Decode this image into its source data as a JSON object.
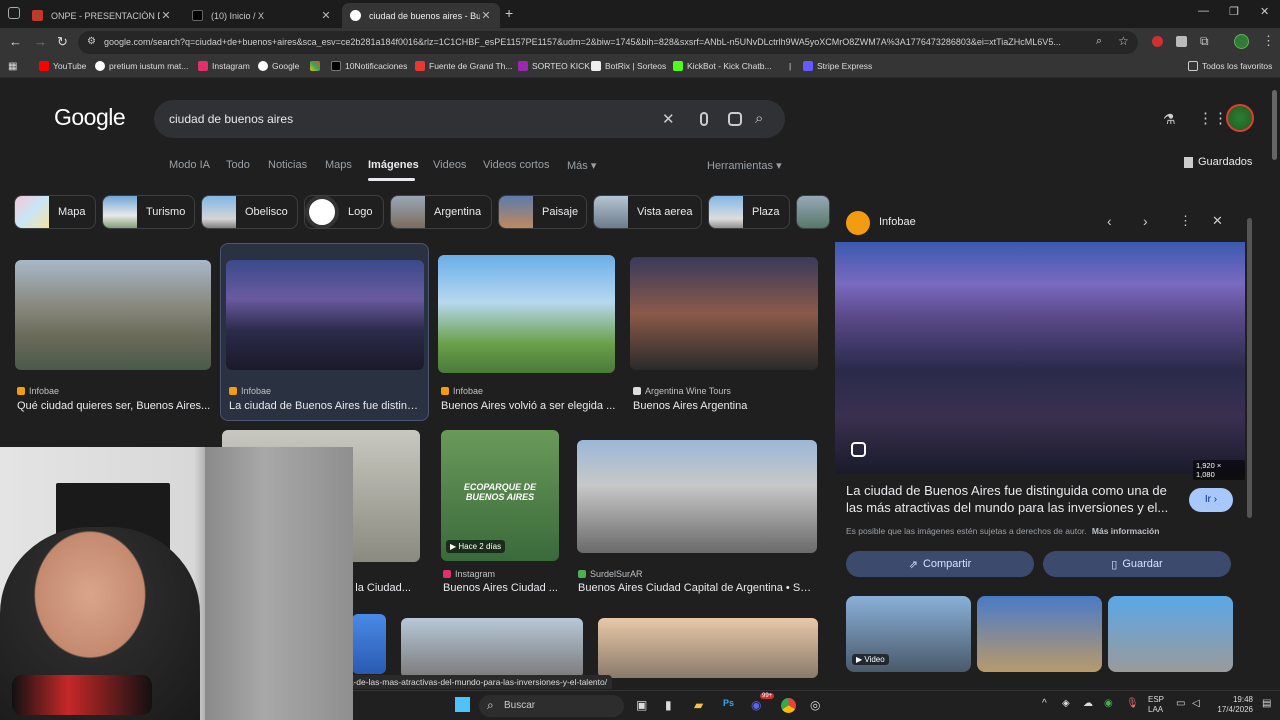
{
  "browser": {
    "tabs": [
      {
        "title": "ONPE - PRESENTACIÓN DE RES",
        "active": false
      },
      {
        "title": "(10) Inicio / X",
        "active": false
      },
      {
        "title": "ciudad de buenos aires - Busca",
        "active": true
      }
    ],
    "url": "google.com/search?q=ciudad+de+buenos+aires&sca_esv=ce2b281a184f0016&rlz=1C1CHBF_esPE1157PE1157&udm=2&biw=1745&bih=828&sxsrf=ANbL-n5UNvDLctrlh9WA5yoXCMrO8ZWM7A%3A1776473286803&ei=xtTiaZHcML6V5...",
    "bookmarks": [
      "YouTube",
      "pretium iustum mat...",
      "Instagram",
      "Google",
      "",
      "10Notificaciones",
      "Fuente de Grand Th...",
      "SORTEO KICK",
      "BotRix | Sorteos",
      "KickBot - Kick Chatb...",
      "|",
      "Stripe Express"
    ],
    "bookmarks_all": "Todos los favoritos"
  },
  "google": {
    "logo": "Google",
    "query": "ciudad de buenos aires",
    "nav": [
      "Modo IA",
      "Todo",
      "Noticias",
      "Maps",
      "Imágenes",
      "Videos",
      "Videos cortos",
      "Más ▾"
    ],
    "tools": "Herramientas ▾",
    "saved": "Guardados",
    "chips": [
      "Mapa",
      "Turismo",
      "Obelisco",
      "Logo",
      "Argentina",
      "Paisaje",
      "Vista aerea",
      "Plaza"
    ],
    "results": [
      {
        "source": "Infobae",
        "title": "Qué ciudad quieres ser, Buenos Aires..."
      },
      {
        "source": "Infobae",
        "title": "La ciudad de Buenos Aires fue disting..."
      },
      {
        "source": "Infobae",
        "title": "Buenos Aires volvió a ser elegida ..."
      },
      {
        "source": "Argentina Wine Tours",
        "title": "Buenos Aires Argentina"
      },
      {
        "source": "",
        "title": "he la Ciudad..."
      },
      {
        "source": "Instagram",
        "title": "Buenos Aires Ciudad ..."
      },
      {
        "source": "SurdelSurAR",
        "title": "Buenos Aires Ciudad Capital de Argentina • Sur..."
      }
    ],
    "ecoparque_label": "ECOPARQUE DE BUENOS AIRES",
    "video_badge": "▶ Hace 2 días"
  },
  "panel": {
    "source": "Infobae",
    "dimensions": "1,920 × 1,080",
    "title": "La ciudad de Buenos Aires fue distinguida como una de las más atractivas del mundo para las inversiones y el...",
    "go": "Ir ›",
    "copyright": "Es posible que las imágenes estén sujetas a derechos de autor.",
    "more_info": "Más información",
    "share": "Compartir",
    "save": "Guardar",
    "video_badge": "▶ Video"
  },
  "status_url": "...ina-de-las-mas-atractivas-del-mundo-para-las-inversiones-y-el-talento/",
  "taskbar": {
    "search": "Buscar",
    "lang1": "ESP",
    "lang2": "LAA",
    "time": "19:48",
    "date": "17/4/2026",
    "badge": "99+"
  },
  "colors": {
    "accent": "#8ab4f8",
    "panel_button": "#3c4a6e",
    "go_button": "#a8c7fa"
  }
}
